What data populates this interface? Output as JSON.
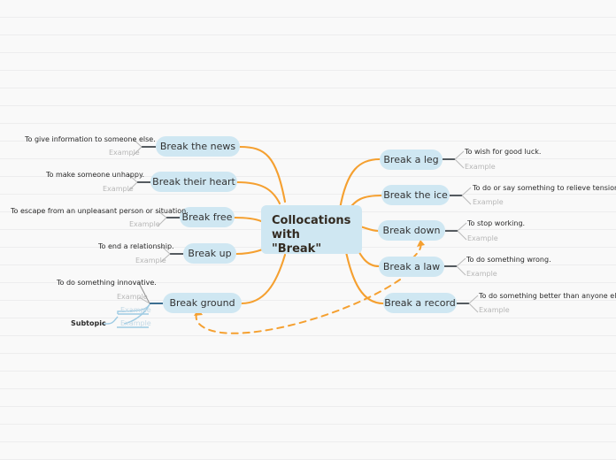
{
  "map": {
    "center": {
      "label": "Collocations\nwith\n\"Break\"",
      "fill": "#cfe7f2",
      "text_color": "#332b22"
    },
    "colors": {
      "branch": "#f5a030",
      "node_fill": "#cfe7f2",
      "node_text": "#333333",
      "leaf_text": "#2a2a2a",
      "example_text": "#b6b6b6",
      "nested_text": "#c3d9e6",
      "nested_link": "#9ecbe3",
      "background": "#f9f9f9",
      "rule_line": "#ededee"
    },
    "left_branches": [
      {
        "label": "Break the news",
        "definition": "To give information to someone else.",
        "example": "Example"
      },
      {
        "label": "Break their heart",
        "definition": "To make someone unhappy.",
        "example": "Example"
      },
      {
        "label": "Break free",
        "definition": "To escape from an unpleasant person or situation.",
        "example": "Example"
      },
      {
        "label": "Break up",
        "definition": "To end a relationship.",
        "example": "Example"
      },
      {
        "label": "Break ground",
        "definition": "To do something innovative.",
        "example": "Example",
        "nested": [
          {
            "label": "Example"
          },
          {
            "label": "Example"
          }
        ],
        "subtopic_label": "Subtopic"
      }
    ],
    "right_branches": [
      {
        "label": "Break a leg",
        "definition": "To wish for good luck.",
        "example": "Example"
      },
      {
        "label": "Break the ice",
        "definition": "To do or say something to relieve tension.",
        "example": "Example"
      },
      {
        "label": "Break down",
        "definition": "To stop working.",
        "example": "Example"
      },
      {
        "label": "Break a law",
        "definition": "To do something wrong.",
        "example": "Example"
      },
      {
        "label": "Break a record",
        "definition": "To do something better than anyone else before",
        "example": "Example"
      }
    ]
  }
}
